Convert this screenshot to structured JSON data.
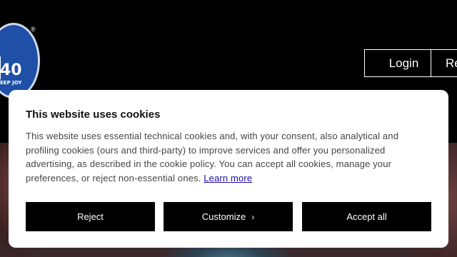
{
  "brand": {
    "logo_number": "40",
    "logo_tagline": "EEP JOY",
    "registered_mark": "®"
  },
  "nav": {
    "login_label": "Login",
    "register_label": "Re"
  },
  "cookie_banner": {
    "title": "This website uses cookies",
    "body": "This website uses essential technical cookies and, with your consent, also analytical and profiling cookies (ours and third-party) to improve services and offer you personalized advertising, as described in the cookie policy. You can accept all cookies, manage your preferences, or reject non-essential ones.",
    "learn_more": "Learn more",
    "reject_label": "Reject",
    "customize_label": "Customize",
    "customize_icon": "chevron-right-icon",
    "accept_label": "Accept all"
  },
  "colors": {
    "logo_blue": "#1f4fa6",
    "button_bg": "#000000",
    "link": "#1a0dab"
  }
}
